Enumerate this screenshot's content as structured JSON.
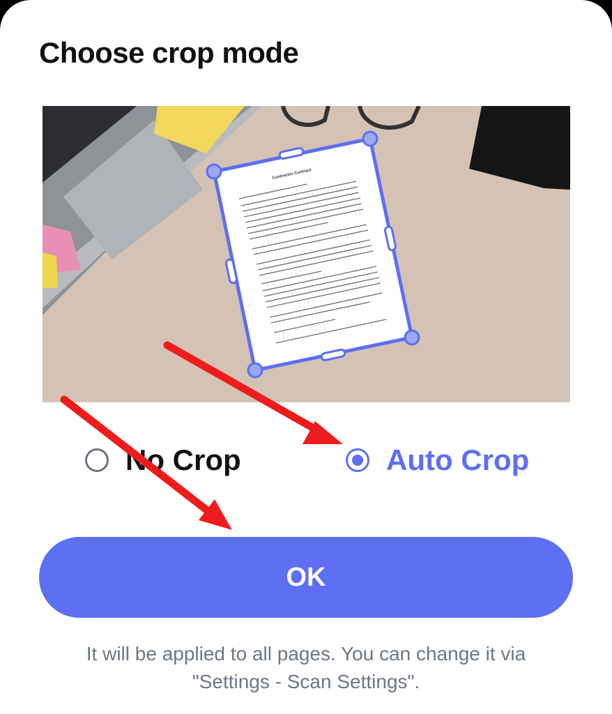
{
  "dialog": {
    "title": "Choose crop mode",
    "options": [
      {
        "label": "No Crop",
        "selected": false
      },
      {
        "label": "Auto Crop",
        "selected": true
      }
    ],
    "ok_label": "OK",
    "note_line1": "It will be applied to all pages. You can change it via",
    "note_line2": "\"Settings - Scan Settings\"."
  },
  "preview": {
    "document_title": "Contractor Contract"
  },
  "colors": {
    "accent": "#5d6ff2",
    "title_text": "#111111",
    "note_text": "#6e7785",
    "arrow": "#ee1c1c",
    "desk": "#d6c6b8"
  },
  "icons": [
    "radio-unchecked-icon",
    "radio-checked-icon",
    "arrow-annotation-icon"
  ]
}
